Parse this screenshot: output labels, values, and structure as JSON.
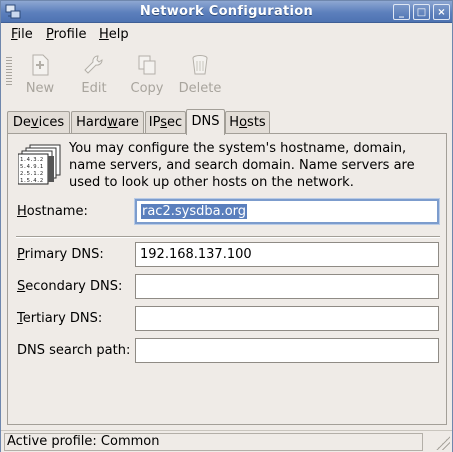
{
  "window": {
    "title": "Network Configuration",
    "controls": {
      "minimize": "_",
      "maximize": "□",
      "close": "×"
    }
  },
  "menubar": {
    "items": [
      {
        "first": "F",
        "rest": "ile"
      },
      {
        "first": "P",
        "rest": "rofile"
      },
      {
        "first": "H",
        "rest": "elp"
      }
    ]
  },
  "toolbar": {
    "new_label": "New",
    "edit_label": "Edit",
    "copy_label": "Copy",
    "delete_label": "Delete",
    "disabled": true
  },
  "tabs": {
    "devices": {
      "pre": "De",
      "u": "v",
      "post": "ices"
    },
    "hardware": {
      "pre": "Hard",
      "u": "w",
      "post": "are"
    },
    "ipsec": {
      "pre": "IP",
      "u": "s",
      "post": "ec"
    },
    "dns": {
      "pre": "",
      "u": "",
      "post": "DNS"
    },
    "hosts": {
      "pre": "H",
      "u": "o",
      "post": "sts"
    },
    "active": "DNS"
  },
  "dns": {
    "description": "You may configure the system's hostname, domain, name servers, and search domain. Name servers are used to look up other hosts on the network.",
    "hostname": {
      "label_u": "H",
      "label_rest": "ostname:",
      "value": "rac2.sysdba.org"
    },
    "primary_dns": {
      "label_u": "P",
      "label_rest": "rimary DNS:",
      "value": "192.168.137.100"
    },
    "secondary_dns": {
      "label_u": "S",
      "label_rest": "econdary DNS:",
      "value": ""
    },
    "tertiary_dns": {
      "label_u": "T",
      "label_rest": "ertiary DNS:",
      "value": ""
    },
    "search_path": {
      "label": "DNS search path:",
      "value": ""
    }
  },
  "status": {
    "text": "Active profile: Common"
  },
  "colors": {
    "titlebar": "#5c7fbc",
    "window_bg": "#efebe7",
    "selection": "#5a7fbd",
    "disabled_text": "#a8a49d"
  }
}
